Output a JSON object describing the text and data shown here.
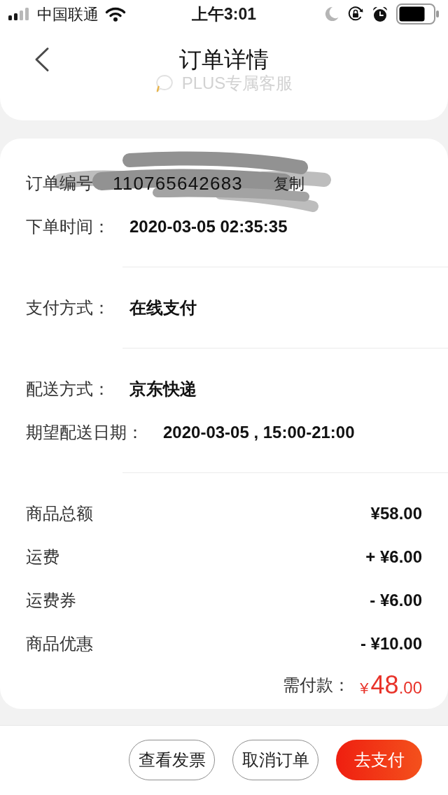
{
  "status_bar": {
    "carrier": "中国联通",
    "time": "上午3:01"
  },
  "header": {
    "title": "订单详情",
    "service_label": "PLUS专属客服"
  },
  "info_sections": [
    {
      "rows": [
        {
          "label": "订单编号",
          "value": "110765642683",
          "action": "复制",
          "redacted": true
        },
        {
          "label": "下单时间：",
          "value": "2020-03-05 02:35:35",
          "redacted": false
        }
      ]
    },
    {
      "rows": [
        {
          "label": "支付方式：",
          "value": "在线支付",
          "redacted": false
        }
      ]
    },
    {
      "rows": [
        {
          "label": "配送方式：",
          "value": "京东快递",
          "redacted": false
        },
        {
          "label": "期望配送日期：",
          "value": "2020-03-05 , 15:00-21:00",
          "redacted": false
        }
      ]
    }
  ],
  "charges": [
    {
      "label": "商品总额",
      "amount": "¥58.00"
    },
    {
      "label": "运费",
      "amount": "+ ¥6.00"
    },
    {
      "label": "运费券",
      "amount": "- ¥6.00"
    },
    {
      "label": "商品优惠",
      "amount": "- ¥10.00"
    }
  ],
  "total": {
    "label": "需付款：",
    "symbol": "¥",
    "main": "48",
    "fraction": ".00"
  },
  "actions": [
    {
      "label": "查看发票",
      "kind": "outline"
    },
    {
      "label": "取消订单",
      "kind": "outline"
    },
    {
      "label": "去支付",
      "kind": "primary"
    }
  ]
}
